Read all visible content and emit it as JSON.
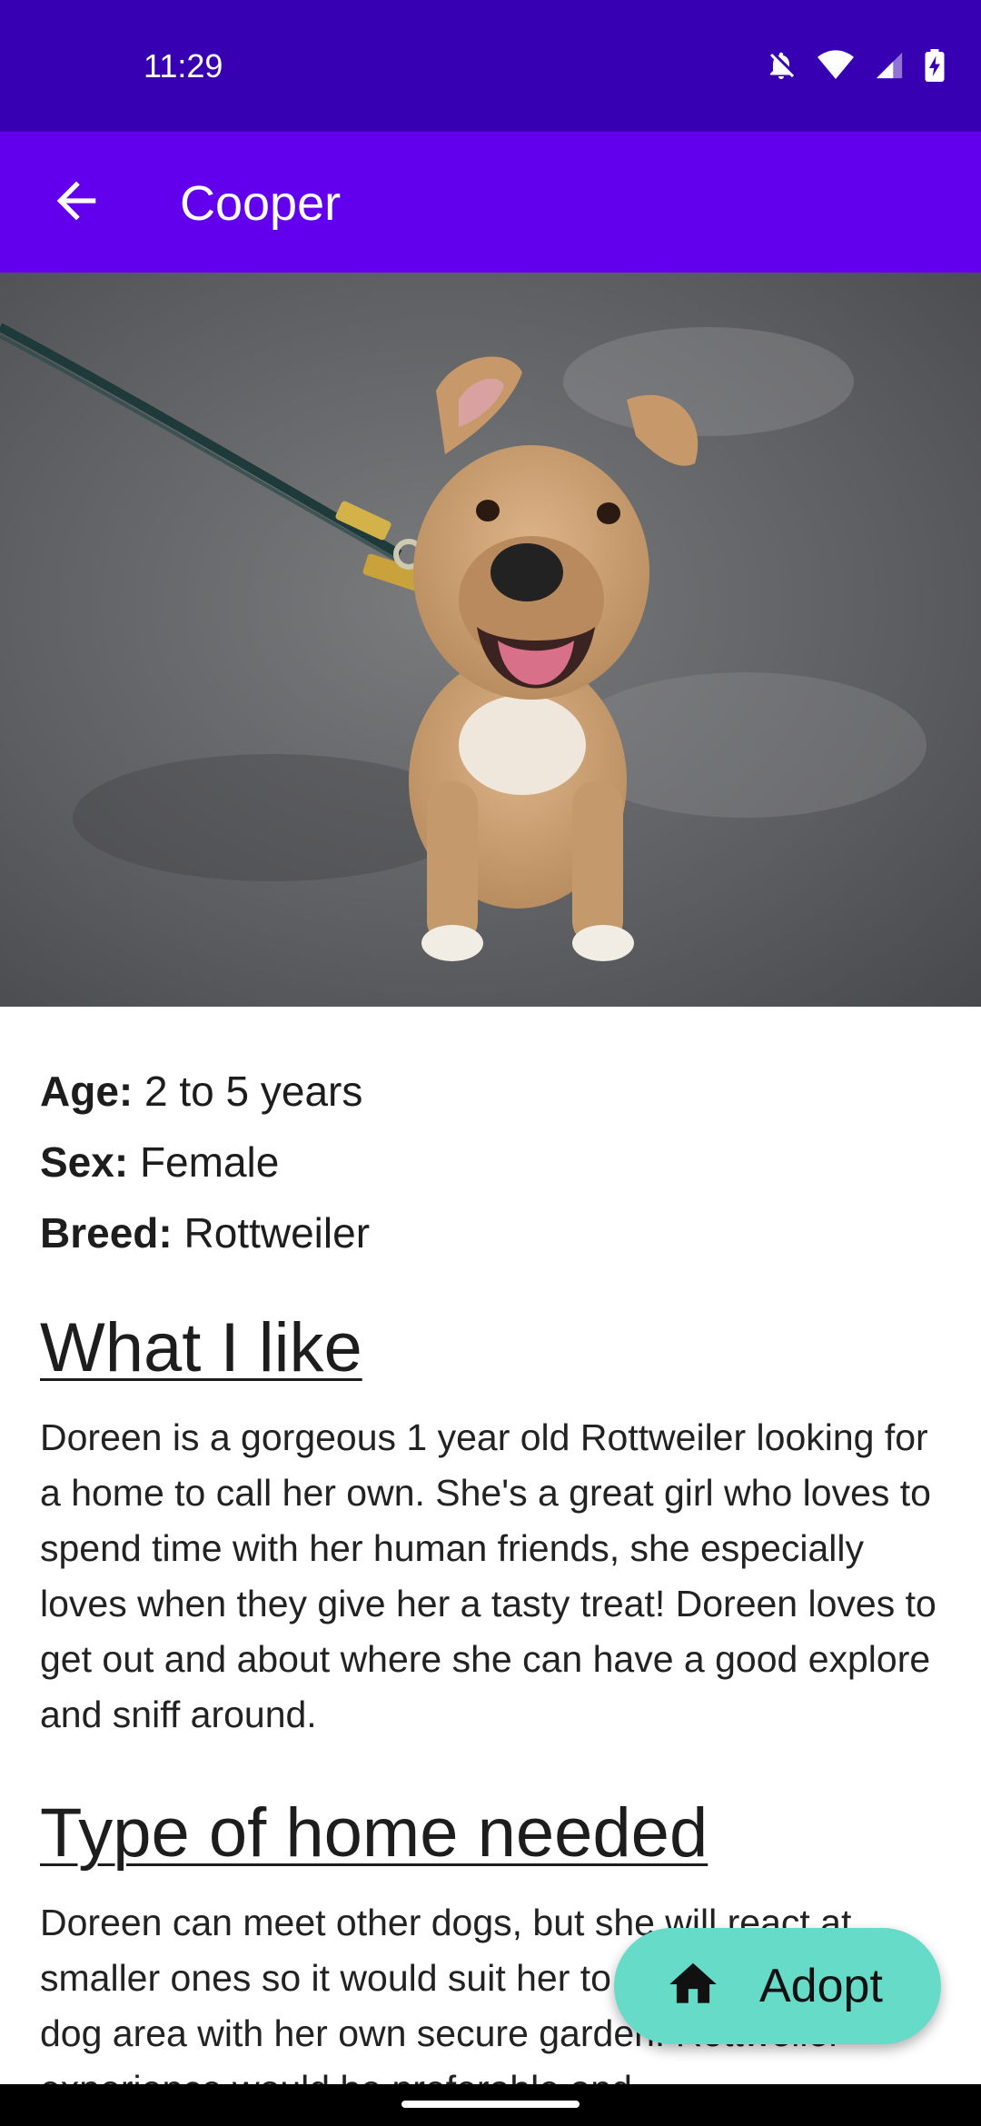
{
  "status_bar": {
    "time": "11:29"
  },
  "app_bar": {
    "title": "Cooper",
    "back_icon": "arrow-back-icon"
  },
  "photo": {
    "subject": "dog-photo"
  },
  "facts": [
    {
      "label": "Age:",
      "value": "2 to 5 years"
    },
    {
      "label": "Sex:",
      "value": "Female"
    },
    {
      "label": "Breed:",
      "value": "Rottweiler"
    }
  ],
  "sections": [
    {
      "heading": "What I like",
      "body": "Doreen is a gorgeous 1 year old Rottweiler looking for a home to call her own. She's a great girl who loves to spend time with her human friends, she especially loves when they give her a tasty treat! Doreen loves to get out and about where she can have a good explore and sniff around."
    },
    {
      "heading": "Type of home needed",
      "body": "Doreen can meet other dogs, but she will react at smaller ones so it would suit her to live in a quieter dog area with her own secure garden. Rottweiler experience would be preferable and"
    }
  ],
  "fab": {
    "label": "Adopt",
    "icon": "home-icon"
  },
  "colors": {
    "status_bar": "#3700b3",
    "app_bar": "#6200ee",
    "fab": "#66dbc8"
  }
}
